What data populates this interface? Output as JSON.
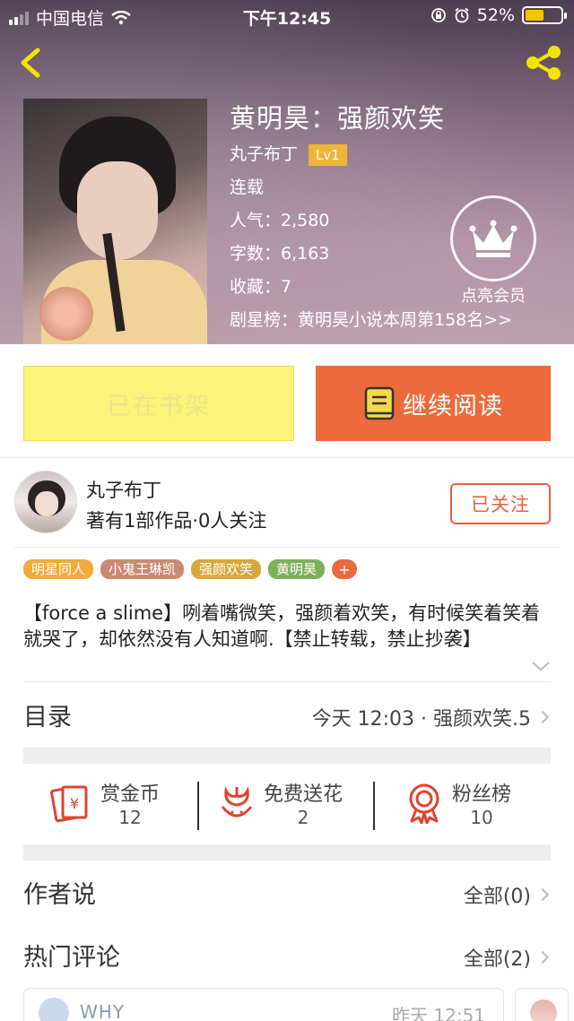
{
  "status_bar": {
    "carrier": "中国电信",
    "time": "下午12:45",
    "battery": "52%"
  },
  "book": {
    "title": "黄明昊：强颜欢笑",
    "author": "丸子布丁",
    "level": "Lv1",
    "state": "连载",
    "popularity": "人气：2,580",
    "word_count": "字数：6,163",
    "favorites": "收藏：7",
    "ranking": "剧星榜：黄明昊小说本周第158名>>"
  },
  "vip": {
    "label": "点亮会员"
  },
  "actions": {
    "on_shelf": "已在书架",
    "continue_reading": "继续阅读"
  },
  "author_card": {
    "name": "丸子布丁",
    "meta": "著有1部作品·0人关注",
    "follow_label": "已关注"
  },
  "tags": [
    {
      "label": "明星同人",
      "color": "#f2aa3c"
    },
    {
      "label": "小鬼王琳凯",
      "color": "#c98a72"
    },
    {
      "label": "强颜欢笑",
      "color": "#d9a73a"
    },
    {
      "label": "黄明昊",
      "color": "#7cb05a"
    }
  ],
  "tag_add": "+",
  "summary": "【force a slime】咧着嘴微笑，强颜着欢笑，有时候笑着笑着就哭了，却依然没有人知道啊.【禁止转载，禁止抄袭】",
  "toc": {
    "title": "目录",
    "latest": "今天 12:03 · 强颜欢笑.5"
  },
  "stats": [
    {
      "label": "赏金币",
      "value": "12"
    },
    {
      "label": "免费送花",
      "value": "2"
    },
    {
      "label": "粉丝榜",
      "value": "10"
    }
  ],
  "author_says": {
    "title": "作者说",
    "link": "全部(0)"
  },
  "hot_comments": {
    "title": "热门评论",
    "link": "全部(2)"
  },
  "comment": {
    "user": "WHY",
    "time": "昨天 12:51"
  },
  "colors": {
    "accent": "#ec6a3c",
    "shelf": "#fdf37a",
    "vip_gold": "#f0b43a"
  }
}
